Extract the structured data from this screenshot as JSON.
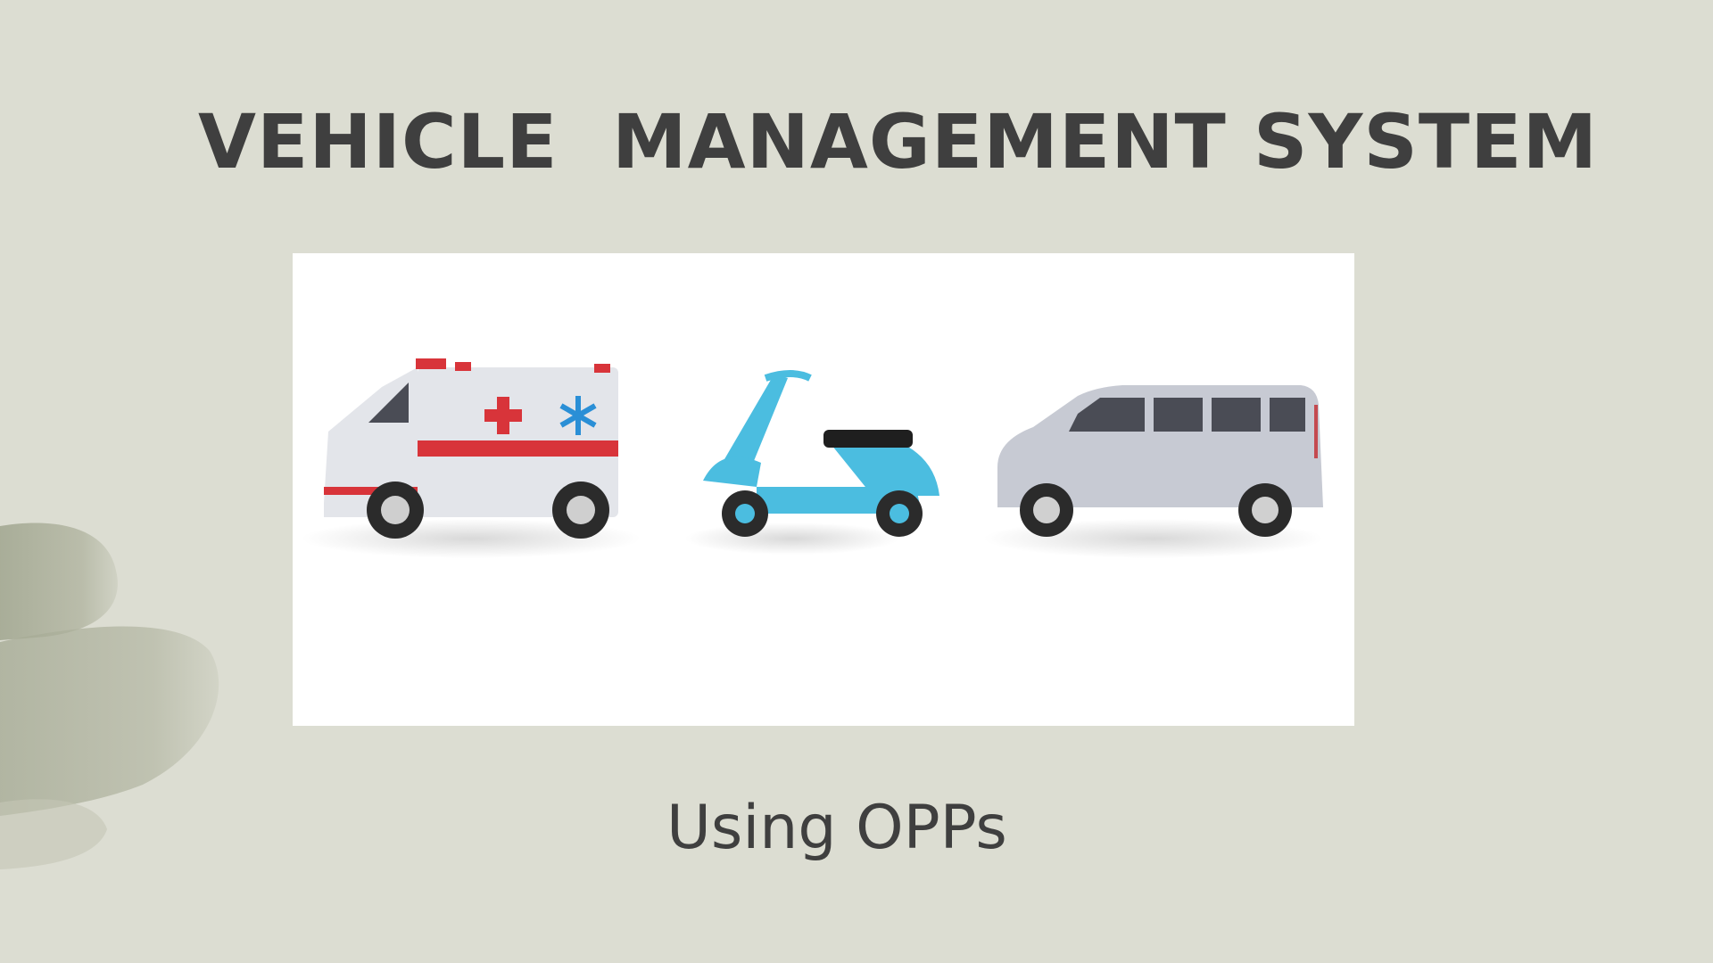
{
  "slide": {
    "title": "VEHICLE  MANAGEMENT SYSTEM",
    "subtitle": "Using OPPs"
  },
  "picture": {
    "vehicles": [
      {
        "kind": "ambulance",
        "icon": "ambulance-icon"
      },
      {
        "kind": "scooter",
        "icon": "scooter-icon"
      },
      {
        "kind": "minivan",
        "icon": "minivan-icon"
      }
    ]
  },
  "colors": {
    "background": "#dcddd2",
    "text": "#3f3f3f",
    "brush": "#a9ad9a",
    "ambulance_body": "#e3e5ea",
    "ambulance_red": "#d8343a",
    "ambulance_blue": "#2a8fd6",
    "scooter_body": "#4bbde0",
    "van_body": "#c7cad3",
    "window": "#4a4c55",
    "tire": "#2b2b2b"
  }
}
